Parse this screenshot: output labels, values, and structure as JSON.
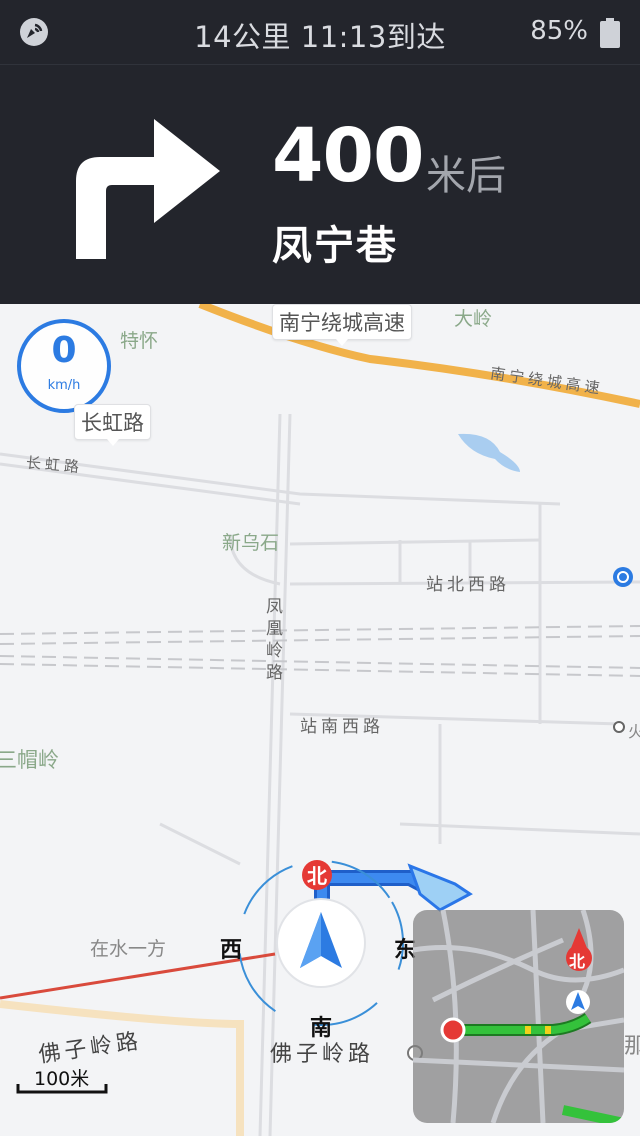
{
  "status_bar": {
    "route_summary": "14公里  11:13到达",
    "battery_percent": "85%",
    "signal_icon": "gps-signal-icon",
    "battery_icon": "battery-icon"
  },
  "navigation": {
    "maneuver_icon": "turn-right-arrow-icon",
    "distance": "400",
    "distance_unit": "米后",
    "next_street": "凤宁巷"
  },
  "map": {
    "speed": {
      "value": "0",
      "unit": "km/h"
    },
    "callouts": {
      "expressway": "南宁绕城高速",
      "changhong": "长虹路"
    },
    "road_labels": {
      "expressway_along": "南宁绕城高速",
      "changhong_along": "长虹路",
      "zhanbei_xi": "站北西路",
      "zhannan_xi": "站南西路",
      "fuziling": "佛子岭路",
      "fuziling_2": "佛子岭路",
      "fenghuangling": [
        "凤",
        "凰",
        "岭",
        "路"
      ]
    },
    "area_labels": {
      "tehuai": "特怀",
      "daling": "大岭",
      "xinwushi": "新乌石",
      "sanmaoling": "三帽岭",
      "zaishuiyifang": "在水一方",
      "na": "那",
      "huo": "火"
    },
    "compass": {
      "north": "北",
      "east": "东",
      "south": "南",
      "west": "西"
    },
    "scale": "100米",
    "minimap": {
      "north_marker": "北"
    },
    "colors": {
      "route_blue": "#2a76e8",
      "traffic_green": "#34c23b",
      "traffic_yellow": "#f0d21b",
      "expressway": "#f1b24a",
      "north_red": "#e53935"
    }
  }
}
